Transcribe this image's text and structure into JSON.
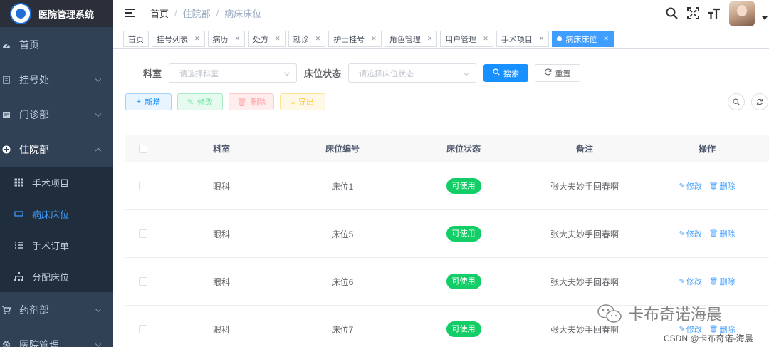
{
  "app": {
    "title": "医院管理系统"
  },
  "sidebar": {
    "items": [
      {
        "label": "首页",
        "icon": "dashboard-icon"
      },
      {
        "label": "挂号处",
        "icon": "register-icon"
      },
      {
        "label": "门诊部",
        "icon": "clinic-icon"
      },
      {
        "label": "住院部",
        "icon": "hospital-icon"
      }
    ],
    "submenu": [
      {
        "label": "手术项目",
        "icon": "table-icon"
      },
      {
        "label": "病床床位",
        "icon": "bed-icon"
      },
      {
        "label": "手术订单",
        "icon": "list-icon"
      },
      {
        "label": "分配床位",
        "icon": "tree-icon"
      }
    ],
    "after": [
      {
        "label": "药剂部",
        "icon": "cart-icon"
      },
      {
        "label": "医院管理",
        "icon": "gear-icon"
      }
    ]
  },
  "breadcrumb": [
    "首页",
    "住院部",
    "病床床位"
  ],
  "tags": [
    "首页",
    "挂号列表",
    "病历",
    "处方",
    "就诊",
    "护士挂号",
    "角色管理",
    "用户管理",
    "手术项目",
    "病床床位"
  ],
  "search": {
    "dept_label": "科室",
    "dept_placeholder": "请选择科室",
    "status_label": "床位状态",
    "status_placeholder": "请选择床位状态",
    "search_btn": "搜索",
    "reset_btn": "重置"
  },
  "toolbar": {
    "add": "新增",
    "edit": "修改",
    "delete": "删除",
    "export": "导出"
  },
  "table": {
    "headers": [
      "科室",
      "床位编号",
      "床位状态",
      "备注",
      "操作"
    ],
    "rows": [
      {
        "dept": "眼科",
        "bed": "床位1",
        "status": "可使用",
        "note": "张大夫妙手回春啊"
      },
      {
        "dept": "眼科",
        "bed": "床位5",
        "status": "可使用",
        "note": "张大夫妙手回春啊"
      },
      {
        "dept": "眼科",
        "bed": "床位6",
        "status": "可使用",
        "note": "张大夫妙手回春啊"
      },
      {
        "dept": "眼科",
        "bed": "床位7",
        "status": "可使用",
        "note": "张大夫妙手回春啊"
      }
    ],
    "op_edit": "修改",
    "op_delete": "删除"
  },
  "watermark": {
    "text": "卡布奇诺海晨",
    "csdn": "CSDN @卡布奇诺-海晨"
  },
  "colors": {
    "sidebar": "#304156",
    "primary": "#1890ff",
    "success": "#13ce66"
  }
}
